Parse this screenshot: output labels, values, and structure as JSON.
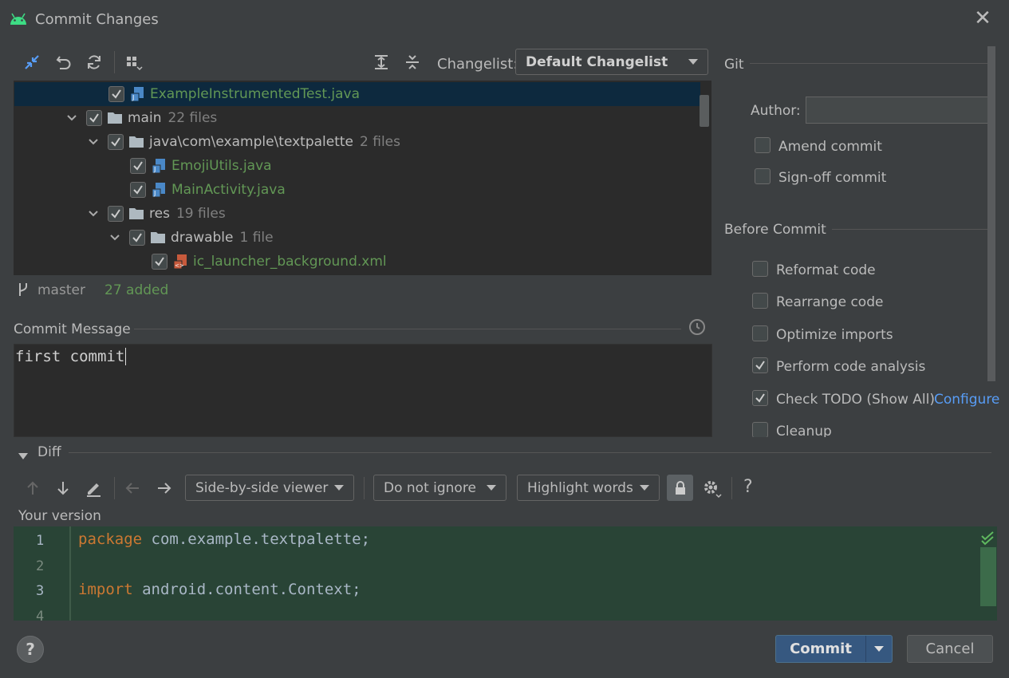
{
  "window": {
    "title": "Commit Changes"
  },
  "toolbar": {
    "changelist_label": "Changelist:",
    "changelist_value": "Default Changelist"
  },
  "tree": {
    "rows": [
      {
        "name": "ExampleInstrumentedTest.java",
        "count": "",
        "type": "java"
      },
      {
        "name": "main",
        "count": "22 files",
        "type": "folder"
      },
      {
        "name": "java\\com\\example\\textpalette",
        "count": "2 files",
        "type": "folder"
      },
      {
        "name": "EmojiUtils.java",
        "count": "",
        "type": "java"
      },
      {
        "name": "MainActivity.java",
        "count": "",
        "type": "java"
      },
      {
        "name": "res",
        "count": "19 files",
        "type": "folder"
      },
      {
        "name": "drawable",
        "count": "1 file",
        "type": "folder"
      },
      {
        "name": "ic_launcher_background.xml",
        "count": "",
        "type": "xml"
      }
    ]
  },
  "status": {
    "branch": "master",
    "added": "27 added"
  },
  "commit_message": {
    "label": "Commit Message",
    "value": "first commit"
  },
  "git": {
    "section_label": "Git",
    "author_label": "Author:",
    "author_value": "",
    "amend_label": "Amend commit",
    "signoff_label": "Sign-off commit"
  },
  "before_commit": {
    "section_label": "Before Commit",
    "items": [
      {
        "label": "Reformat code",
        "checked": false
      },
      {
        "label": "Rearrange code",
        "checked": false
      },
      {
        "label": "Optimize imports",
        "checked": false
      },
      {
        "label": "Perform code analysis",
        "checked": true
      },
      {
        "label": "Check TODO (Show All)",
        "checked": true
      },
      {
        "label": "Cleanup",
        "checked": false
      }
    ],
    "configure_link": "Configure"
  },
  "diff": {
    "label": "Diff",
    "viewer": "Side-by-side viewer",
    "ignore": "Do not ignore",
    "highlight": "Highlight words",
    "your_version": "Your version",
    "lines": [
      {
        "num": "1",
        "kw": "package",
        "rest": " com.example.textpalette;"
      },
      {
        "num": "2",
        "kw": "",
        "rest": ""
      },
      {
        "num": "3",
        "kw": "import",
        "rest": " android.content.Context;"
      },
      {
        "num": "4",
        "kw": "",
        "rest": ""
      }
    ]
  },
  "buttons": {
    "commit": "Commit",
    "cancel": "Cancel"
  },
  "colors": {
    "accent_blue": "#589df6",
    "added_green": "#629755",
    "keyword": "#cc7832"
  }
}
